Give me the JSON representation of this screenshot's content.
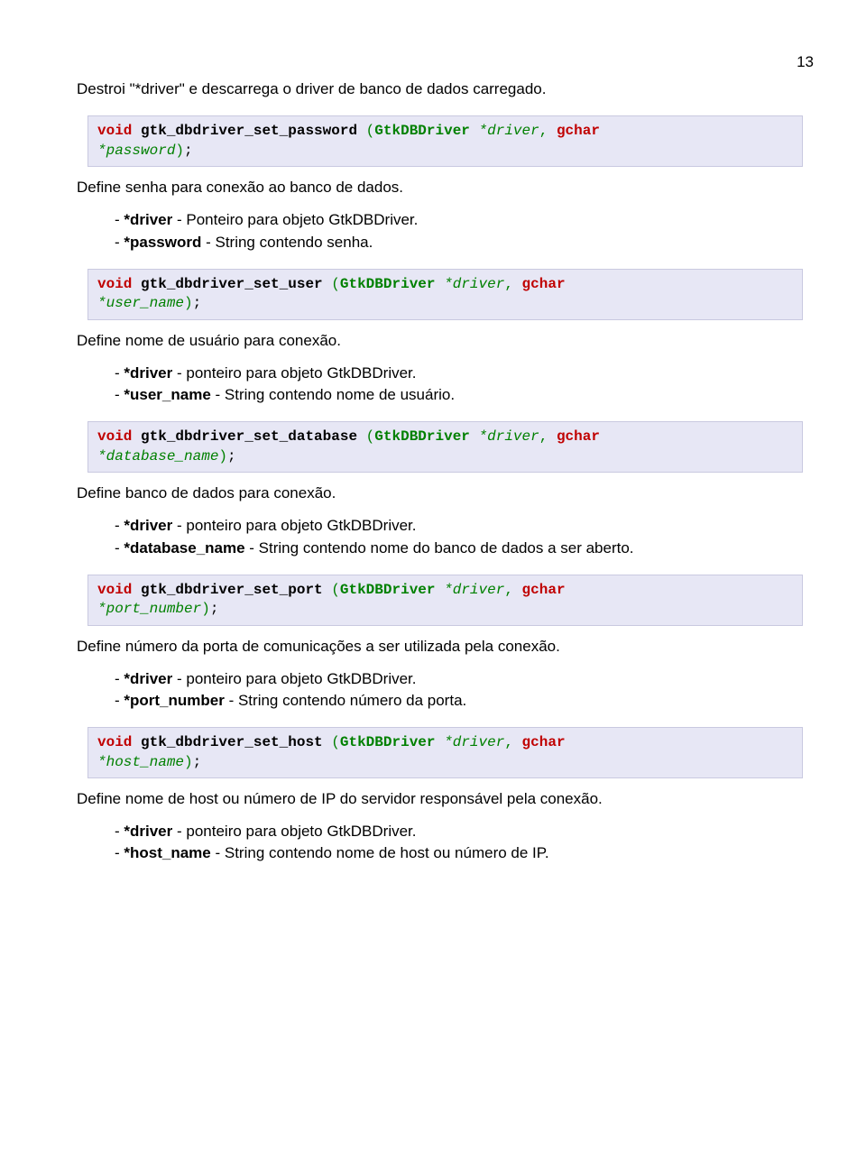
{
  "page_number": "13",
  "sec1": {
    "intro": "Destroi \"*driver\" e descarrega o driver de banco de dados carregado.",
    "code": {
      "ret": "void",
      "func": "gtk_dbdriver_set_password",
      "lp": "(",
      "cls": "GtkDBDriver",
      "arg1": "*driver",
      "comma": ",",
      "ptype": "gchar",
      "arg2": "*password",
      "rp": ")",
      "semi": ";"
    },
    "desc": "Define senha para conexão ao banco de dados.",
    "p1a": "*driver",
    "p1b": " - Ponteiro para objeto GtkDBDriver.",
    "p2a": "*password",
    "p2b": " - String contendo senha."
  },
  "sec2": {
    "code": {
      "ret": "void",
      "func": "gtk_dbdriver_set_user",
      "lp": "(",
      "cls": "GtkDBDriver",
      "arg1": "*driver",
      "comma": ",",
      "ptype": "gchar",
      "arg2": "*user_name",
      "rp": ")",
      "semi": ";"
    },
    "desc": "Define nome de usuário para conexão.",
    "p1a": "*driver",
    "p1b": " - ponteiro para objeto GtkDBDriver.",
    "p2a": "*user_name",
    "p2b": " - String contendo nome de usuário."
  },
  "sec3": {
    "code": {
      "ret": "void",
      "func": "gtk_dbdriver_set_database",
      "lp": "(",
      "cls": "GtkDBDriver",
      "arg1": "*driver",
      "comma": ",",
      "ptype": "gchar",
      "arg2": "*database_name",
      "rp": ")",
      "semi": ";"
    },
    "desc": "Define banco de dados para conexão.",
    "p1a": "*driver",
    "p1b": " - ponteiro para objeto GtkDBDriver.",
    "p2a": "*database_name",
    "p2b": " - String contendo nome do banco de dados a ser aberto."
  },
  "sec4": {
    "code": {
      "ret": "void",
      "func": "gtk_dbdriver_set_port",
      "lp": "(",
      "cls": "GtkDBDriver",
      "arg1": "*driver",
      "comma": ",",
      "ptype": "gchar",
      "arg2": "*port_number",
      "rp": ")",
      "semi": ";"
    },
    "desc": "Define número da porta de comunicações a ser utilizada pela conexão.",
    "p1a": "*driver",
    "p1b": " - ponteiro para objeto GtkDBDriver.",
    "p2a": "*port_number",
    "p2b": " - String contendo número da porta."
  },
  "sec5": {
    "code": {
      "ret": "void",
      "func": "gtk_dbdriver_set_host",
      "lp": "(",
      "cls": "GtkDBDriver",
      "arg1": "*driver",
      "comma": ",",
      "ptype": "gchar",
      "arg2": "*host_name",
      "rp": ")",
      "semi": ";"
    },
    "desc": "Define nome de host ou número de IP do servidor responsável pela conexão.",
    "p1a": "*driver",
    "p1b": " - ponteiro para objeto GtkDBDriver.",
    "p2a": "*host_name",
    "p2b": " - String contendo nome de host ou número de IP."
  }
}
